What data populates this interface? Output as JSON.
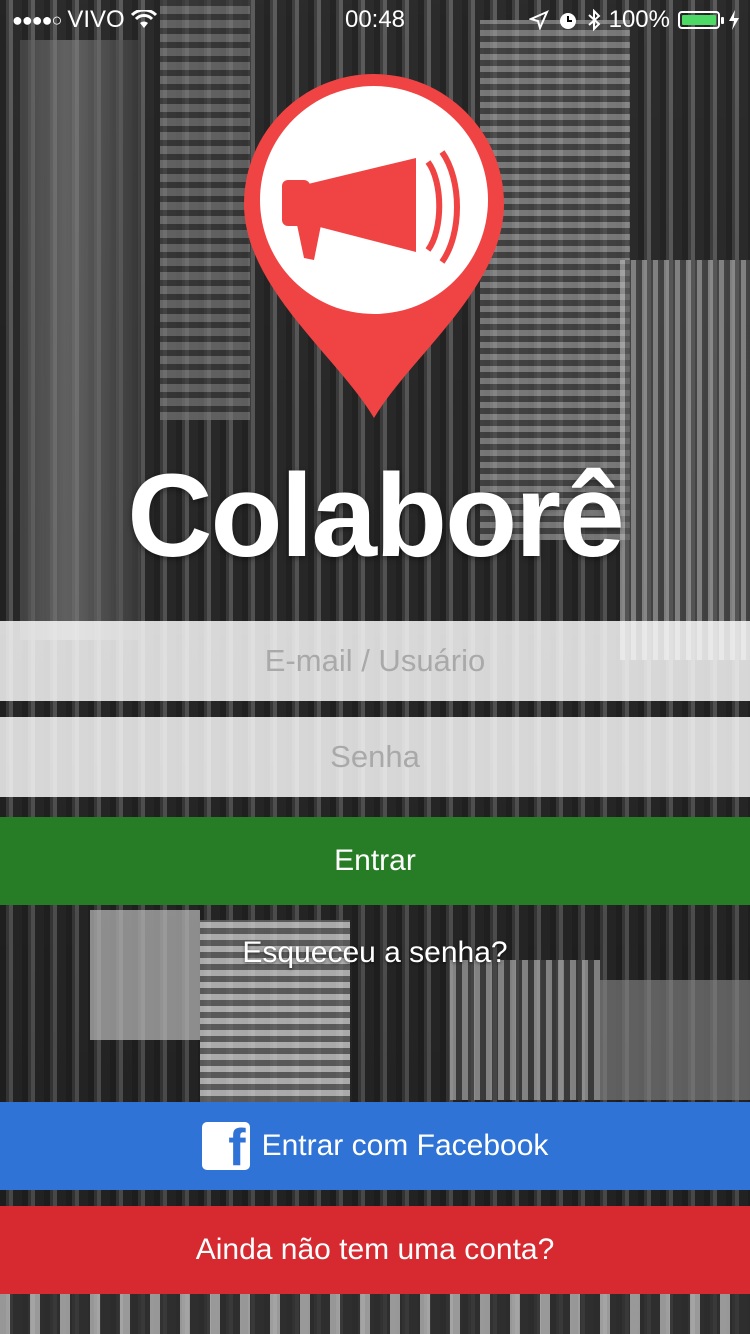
{
  "status_bar": {
    "signal": "●●●●○",
    "carrier": "VIVO",
    "time": "00:48",
    "battery_pct": "100%",
    "battery_level": 1.0
  },
  "colors": {
    "pin_red": "#f04444",
    "login_green": "#267d26",
    "facebook_blue": "#2f73d6",
    "signup_red": "#d62a30"
  },
  "logo": {
    "icon": "megaphone-pin-icon"
  },
  "brand": {
    "name": "Colaborê"
  },
  "form": {
    "email_placeholder": "E-mail / Usuário",
    "email_value": "",
    "password_placeholder": "Senha",
    "password_value": ""
  },
  "buttons": {
    "login": "Entrar",
    "forgot": "Esqueceu a senha?",
    "facebook": "Entrar com Facebook",
    "facebook_icon": "facebook-icon",
    "signup": "Ainda não tem uma conta?"
  }
}
